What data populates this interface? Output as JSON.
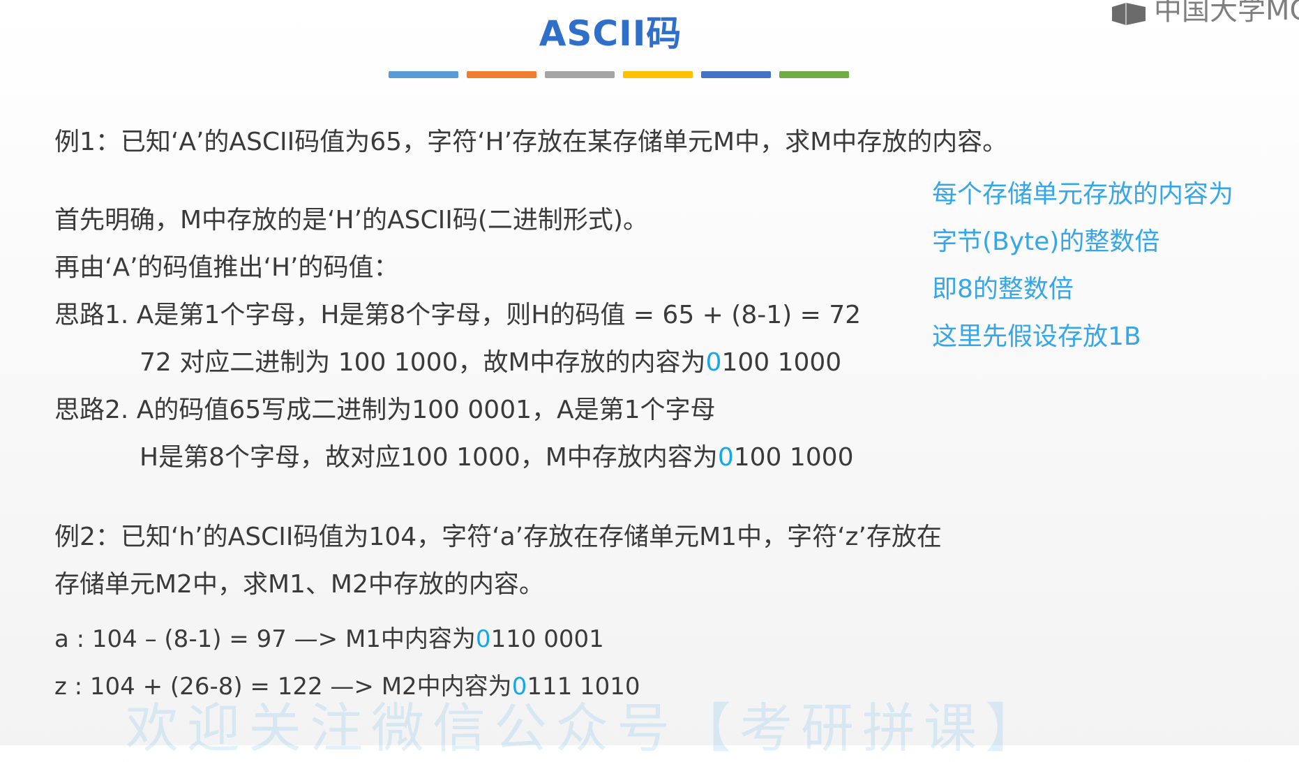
{
  "slide": {
    "title": "ASCII码",
    "logo_text": "中国大学MO",
    "accent_bars": [
      "#5b9bd5",
      "#ed7d31",
      "#a5a5a5",
      "#ffc000",
      "#4472c4",
      "#70ad47"
    ]
  },
  "example1": {
    "question": "例1：已知‘A’的ASCII码值为65，字符‘H’存放在某存储单元M中，求M中存放的内容。",
    "line1": "首先明确，M中存放的是‘H’的ASCII码(二进制形式)。",
    "line2": "再由‘A’的码值推出‘H’的码值：",
    "idea1": "思路1. A是第1个字母，H是第8个字母，则H的码值 = 65 + (8-1)  = 72",
    "idea1_detail_prefix": "72 对应二进制为 100 1000，故M中存放的内容为",
    "idea1_detail_hl": "0",
    "idea1_detail_suffix": "100 1000",
    "idea2": "思路2. A的码值65写成二进制为100 0001，A是第1个字母",
    "idea2_detail_prefix": "H是第8个字母，故对应100 1000，M中存放内容为",
    "idea2_detail_hl": "0",
    "idea2_detail_suffix": "100 1000"
  },
  "side_note": {
    "line1": "每个存储单元存放的内容为",
    "line2": "字节(Byte)的整数倍",
    "line3": "即8的整数倍",
    "line4": "这里先假设存放1B"
  },
  "example2": {
    "question_line1": "例2：已知‘h’的ASCII码值为104，字符‘a’存放在存储单元M1中，字符‘z’存放在",
    "question_line2": "存储单元M2中，求M1、M2中存放的内容。",
    "calc_a_prefix": "a : 104 – (8-1) = 97  —> M1中内容为",
    "calc_a_hl": "0",
    "calc_a_suffix": "110 0001",
    "calc_z_prefix": "z : 104 + (26-8) = 122 —> M2中内容为",
    "calc_z_hl": "0",
    "calc_z_suffix": "111 1010"
  },
  "watermark": "欢迎关注微信公众号【考研拼课】"
}
